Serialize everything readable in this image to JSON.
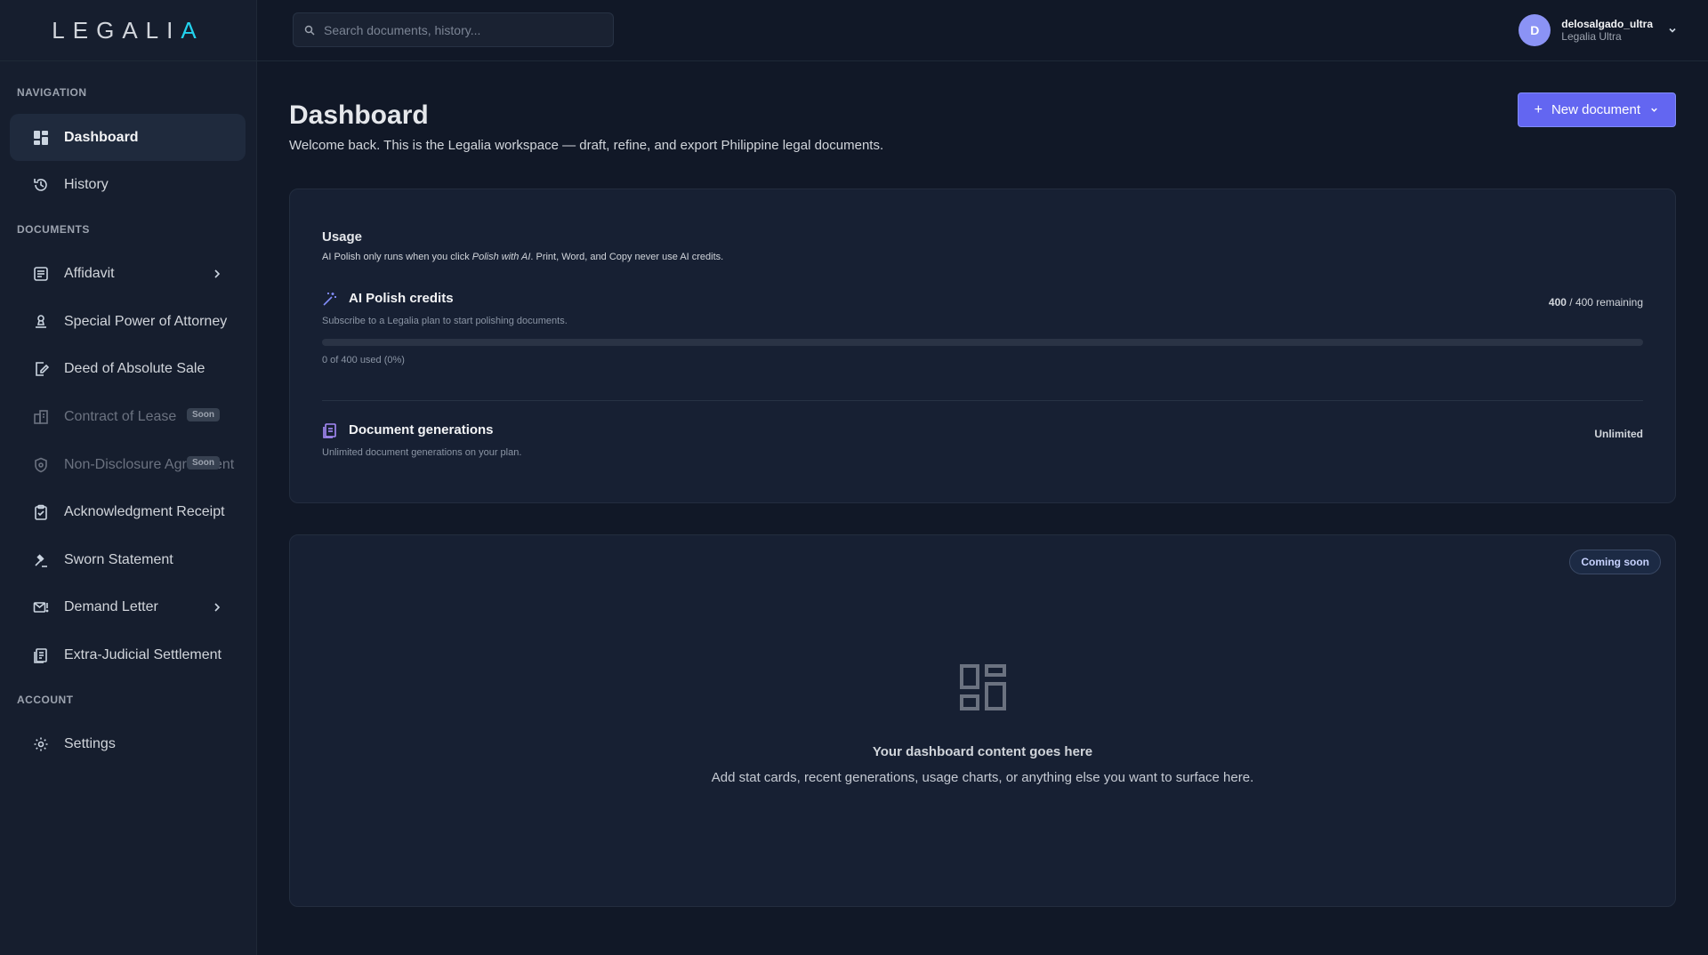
{
  "brand": {
    "logo_main": "LEGALI",
    "logo_accent": "A"
  },
  "search": {
    "placeholder": "Search documents, history..."
  },
  "user": {
    "initial": "D",
    "name": "delosalgado_ultra",
    "plan": "Legalia Ultra"
  },
  "sidebar": {
    "sections": {
      "navigation": "NAVIGATION",
      "documents": "DOCUMENTS",
      "account": "ACCOUNT"
    },
    "nav": {
      "dashboard": "Dashboard",
      "history": "History"
    },
    "docs": {
      "affidavit": "Affidavit",
      "spa": "Special Power of Attorney",
      "deed": "Deed of Absolute Sale",
      "lease": "Contract of Lease",
      "nda": "Non-Disclosure Agreement",
      "receipt": "Acknowledgment Receipt",
      "sworn": "Sworn Statement",
      "demand": "Demand Letter",
      "settlement": "Extra-Judicial Settlement"
    },
    "soon_label": "Soon",
    "account": {
      "settings": "Settings"
    }
  },
  "page": {
    "title": "Dashboard",
    "subtitle": "Welcome back. This is the Legalia workspace — draft, refine, and export Philippine legal documents.",
    "new_doc_label": "New document"
  },
  "usage": {
    "title": "Usage",
    "desc_prefix": "AI Polish only runs when you click ",
    "desc_em": "Polish with AI",
    "desc_suffix": ". Print, Word, and Copy never use AI credits.",
    "ai": {
      "title": "AI Polish credits",
      "desc": "Subscribe to a Legalia plan to start polishing documents.",
      "remaining_strong": "400",
      "remaining_rest": " / 400 remaining",
      "used_text": "0 of 400 used (0%)",
      "used_fraction": 0
    },
    "gen": {
      "title": "Document generations",
      "desc": "Unlimited document generations on your plan.",
      "value": "Unlimited"
    }
  },
  "placeholder": {
    "badge": "Coming soon",
    "title": "Your dashboard content goes here",
    "subtitle": "Add stat cards, recent generations, usage charts, or anything else you want to surface here."
  }
}
